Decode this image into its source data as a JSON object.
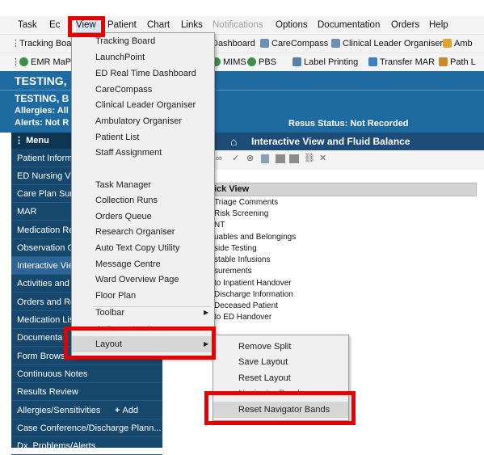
{
  "menubar": {
    "items": [
      "Task",
      "Ec",
      "View",
      "Patient",
      "Chart",
      "Links",
      "Notifications",
      "Options",
      "Documentation",
      "Orders",
      "Help"
    ]
  },
  "toolbar1": {
    "items": [
      "Tracking Boa",
      "Dashboard",
      "CareCompass",
      "Clinical Leader Organiser",
      "Amb"
    ]
  },
  "toolbar2": {
    "items": [
      "EMR MaP",
      "MIMS",
      "PBS",
      "Label Printing",
      "Transfer MAR",
      "Path L"
    ]
  },
  "banner": {
    "name_top": "TESTING,",
    "name_full": "TESTING, B",
    "allergies": "Allergies: All",
    "alerts": "Alerts: Not R",
    "resus": "Resus Status: Not Recorded"
  },
  "leftnav": {
    "menu_label": "Menu",
    "items": [
      "Patient Inform",
      "ED Nursing Vi",
      "Care Plan Sum",
      "MAR",
      "Medication Re",
      "Observation C",
      "Interactive Vie",
      "Activities and",
      "Orders and Re",
      "Medication Lis",
      "Documenta",
      "Form Brows",
      "Continuous Notes",
      "Results Review",
      "Allergies/Sensitivities",
      "Case Conference/Discharge Plann...",
      "Dx, Problems/Alerts"
    ],
    "add_label": "Add"
  },
  "content": {
    "title": "Interactive View and Fluid Balance",
    "quick_view_header": "t Quick View",
    "rows": [
      "Triage Comments",
      "Risk Screening",
      "NT",
      "uables and Belongings",
      "side Testing",
      "stable Infusions",
      "surements",
      "to Inpatient Handover",
      "Discharge Information",
      "Deceased Patient",
      "to ED Handover"
    ]
  },
  "view_menu": {
    "items": [
      "Tracking Board",
      "LaunchPoint",
      "ED Real Time Dashboard",
      "CareCompass",
      "Clinical Leader Organiser",
      "Ambulatory Organiser",
      "Patient List",
      "Staff Assignment",
      "",
      "Task Manager",
      "Collection Runs",
      "Orders Queue",
      "Research Organiser",
      "Auto Text Copy Utility",
      "Message Centre",
      "Ward Overview Page",
      "Floor Plan"
    ],
    "toolbar": "Toolbar",
    "collapse": "Collapse Navigator",
    "layout": "Layout"
  },
  "layout_submenu": {
    "items": [
      "Remove Split",
      "Save Layout",
      "Reset Layout",
      "Navigator Bands",
      "Reset Navigator Bands"
    ]
  },
  "colors": {
    "highlight_red": "#e60000",
    "banner_blue": "#1e6ba1",
    "nav_blue": "#16486e"
  }
}
